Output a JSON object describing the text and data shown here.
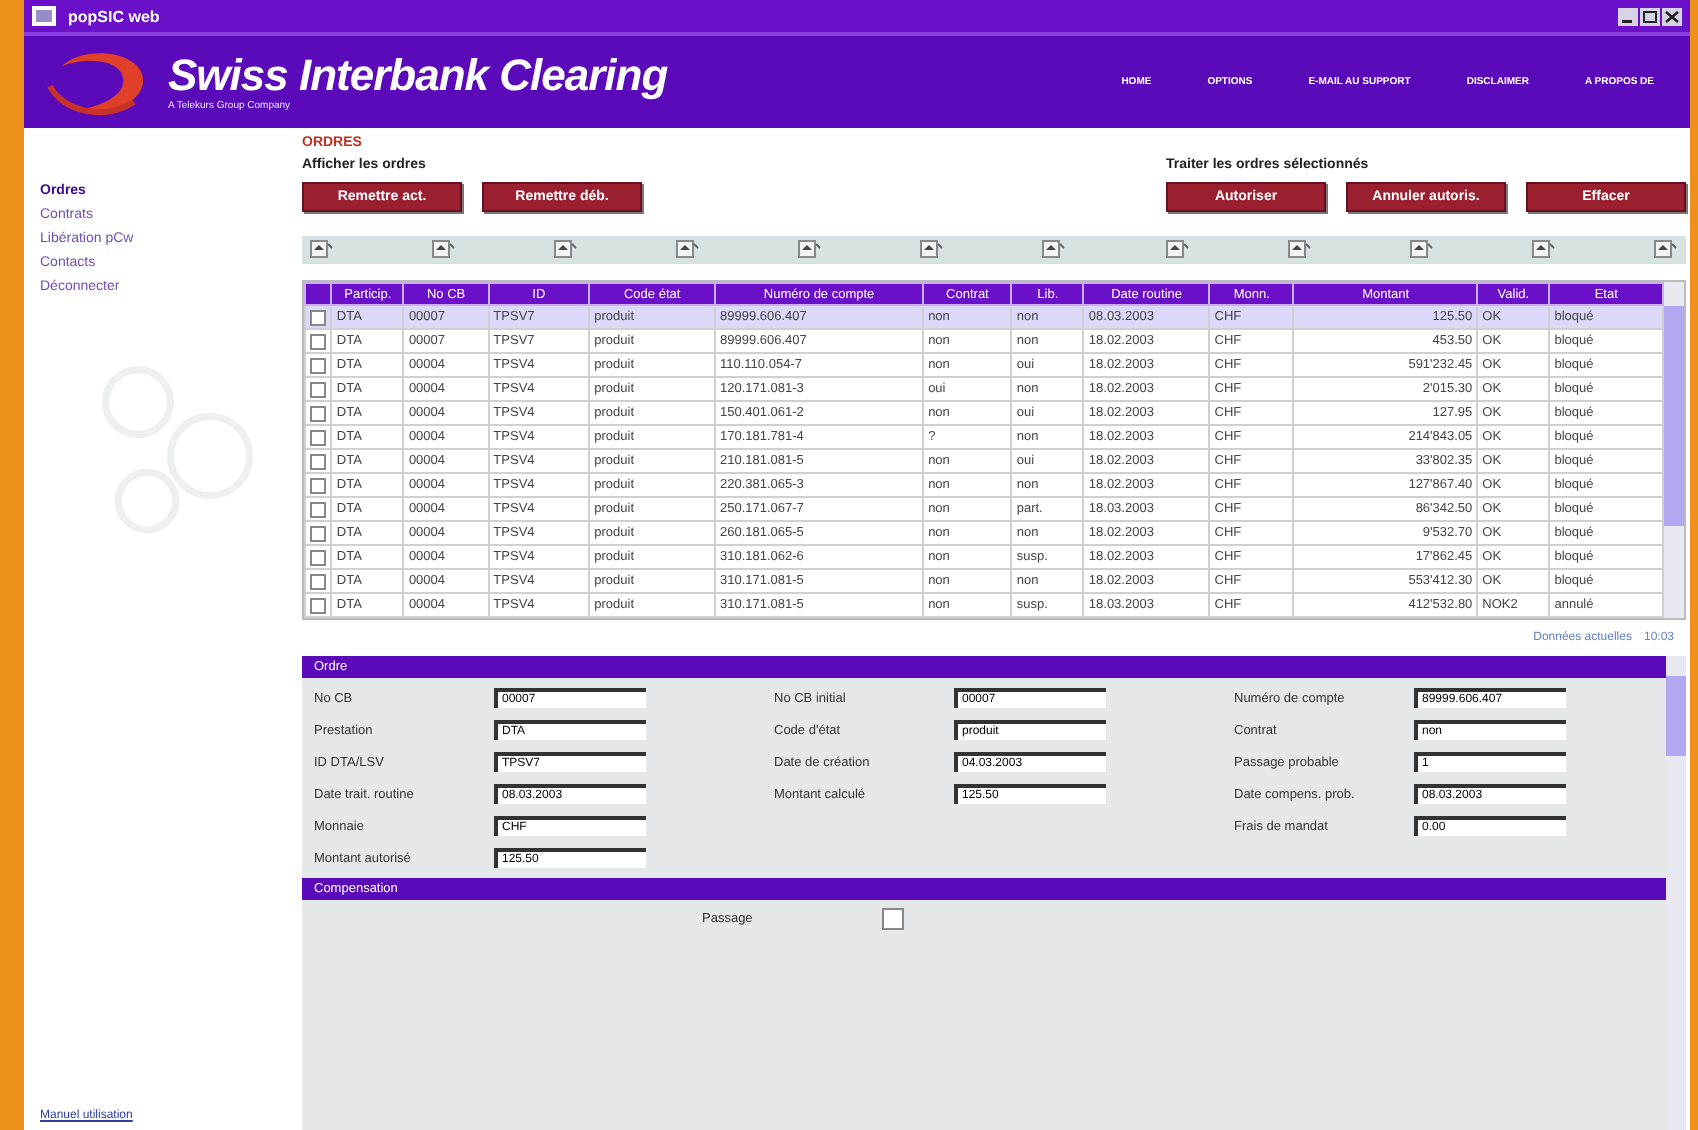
{
  "window": {
    "title": "popSIC web"
  },
  "header": {
    "brand": "Swiss Interbank Clearing",
    "tagline": "A Telekurs Group Company",
    "nav": [
      "HOME",
      "OPTIONS",
      "E-MAIL AU SUPPORT",
      "DISCLAIMER",
      "A PROPOS DE"
    ]
  },
  "sidebar": {
    "items": [
      {
        "label": "Ordres",
        "selected": true
      },
      {
        "label": "Contrats",
        "selected": false
      },
      {
        "label": "Libération pCw",
        "selected": false
      },
      {
        "label": "Contacts",
        "selected": false
      },
      {
        "label": "Déconnecter",
        "selected": false
      }
    ],
    "footer_link": "Manuel utilisation"
  },
  "page_title": "ORDRES",
  "show_group": {
    "label": "Afficher les ordres",
    "buttons": [
      "Remettre act.",
      "Remettre déb."
    ]
  },
  "process_group": {
    "label": "Traiter les ordres sélectionnés",
    "buttons": [
      "Autoriser",
      "Annuler autoris.",
      "Effacer"
    ]
  },
  "table": {
    "columns": [
      "Particip.",
      "No CB",
      "ID",
      "Code état",
      "Numéro de compte",
      "Contrat",
      "Lib.",
      "Date routine",
      "Monn.",
      "Montant",
      "Valid.",
      "Etat"
    ],
    "rows": [
      {
        "selected": true,
        "checked": false,
        "cells": [
          "DTA",
          "00007",
          "TPSV7",
          "produit",
          "89999.606.407",
          "non",
          "non",
          "08.03.2003",
          "CHF",
          "125.50",
          "OK",
          "bloqué"
        ]
      },
      {
        "selected": false,
        "checked": false,
        "cells": [
          "DTA",
          "00007",
          "TPSV7",
          "produit",
          "89999.606.407",
          "non",
          "non",
          "18.02.2003",
          "CHF",
          "453.50",
          "OK",
          "bloqué"
        ]
      },
      {
        "selected": false,
        "checked": false,
        "cells": [
          "DTA",
          "00004",
          "TPSV4",
          "produit",
          "110.110.054-7",
          "non",
          "oui",
          "18.02.2003",
          "CHF",
          "591'232.45",
          "OK",
          "bloqué"
        ]
      },
      {
        "selected": false,
        "checked": false,
        "cells": [
          "DTA",
          "00004",
          "TPSV4",
          "produit",
          "120.171.081-3",
          "oui",
          "non",
          "18.02.2003",
          "CHF",
          "2'015.30",
          "OK",
          "bloqué"
        ]
      },
      {
        "selected": false,
        "checked": false,
        "cells": [
          "DTA",
          "00004",
          "TPSV4",
          "produit",
          "150.401.061-2",
          "non",
          "oui",
          "18.02.2003",
          "CHF",
          "127.95",
          "OK",
          "bloqué"
        ]
      },
      {
        "selected": false,
        "checked": false,
        "cells": [
          "DTA",
          "00004",
          "TPSV4",
          "produit",
          "170.181.781-4",
          "?",
          "non",
          "18.02.2003",
          "CHF",
          "214'843.05",
          "OK",
          "bloqué"
        ]
      },
      {
        "selected": false,
        "checked": false,
        "cells": [
          "DTA",
          "00004",
          "TPSV4",
          "produit",
          "210.181.081-5",
          "non",
          "oui",
          "18.02.2003",
          "CHF",
          "33'802.35",
          "OK",
          "bloqué"
        ]
      },
      {
        "selected": false,
        "checked": false,
        "cells": [
          "DTA",
          "00004",
          "TPSV4",
          "produit",
          "220.381.065-3",
          "non",
          "non",
          "18.02.2003",
          "CHF",
          "127'867.40",
          "OK",
          "bloqué"
        ]
      },
      {
        "selected": false,
        "checked": false,
        "cells": [
          "DTA",
          "00004",
          "TPSV4",
          "produit",
          "250.171.067-7",
          "non",
          "part.",
          "18.03.2003",
          "CHF",
          "86'342.50",
          "OK",
          "bloqué"
        ]
      },
      {
        "selected": false,
        "checked": false,
        "cells": [
          "DTA",
          "00004",
          "TPSV4",
          "produit",
          "260.181.065-5",
          "non",
          "non",
          "18.02.2003",
          "CHF",
          "9'532.70",
          "OK",
          "bloqué"
        ]
      },
      {
        "selected": false,
        "checked": false,
        "cells": [
          "DTA",
          "00004",
          "TPSV4",
          "produit",
          "310.181.062-6",
          "non",
          "susp.",
          "18.02.2003",
          "CHF",
          "17'862.45",
          "OK",
          "bloqué"
        ]
      },
      {
        "selected": false,
        "checked": false,
        "cells": [
          "DTA",
          "00004",
          "TPSV4",
          "produit",
          "310.171.081-5",
          "non",
          "non",
          "18.02.2003",
          "CHF",
          "553'412.30",
          "OK",
          "bloqué"
        ]
      },
      {
        "selected": false,
        "checked": false,
        "cells": [
          "DTA",
          "00004",
          "TPSV4",
          "produit",
          "310.171.081-5",
          "non",
          "susp.",
          "18.03.2003",
          "CHF",
          "412'532.80",
          "NOK2",
          "annulé"
        ]
      }
    ]
  },
  "data_status": {
    "label": "Données actuelles",
    "time": "10:03"
  },
  "order_panel": {
    "title": "Ordre",
    "fields": [
      [
        {
          "label": "No CB",
          "value": "00007"
        },
        {
          "label": "Prestation",
          "value": "DTA"
        },
        {
          "label": "ID DTA/LSV",
          "value": "TPSV7"
        },
        {
          "label": "Date trait. routine",
          "value": "08.03.2003"
        },
        {
          "label": "Monnaie",
          "value": "CHF"
        },
        {
          "label": "Montant autorisé",
          "value": "125.50"
        }
      ],
      [
        {
          "label": "No CB initial",
          "value": "00007"
        },
        {
          "label": "Code d'état",
          "value": "produit"
        },
        {
          "label": "Date de création",
          "value": "04.03.2003"
        },
        {
          "label": "Montant calculé",
          "value": "125.50"
        }
      ],
      [
        {
          "label": "Numéro de compte",
          "value": "89999.606.407"
        },
        {
          "label": "Contrat",
          "value": "non"
        },
        {
          "label": "Passage probable",
          "value": "1"
        },
        {
          "label": "Date compens. prob.",
          "value": "08.03.2003"
        },
        {
          "label": "Frais de mandat",
          "value": "0.00"
        }
      ]
    ]
  },
  "compensation_panel": {
    "title": "Compensation",
    "field": {
      "label": "Passage",
      "checked": false
    }
  }
}
